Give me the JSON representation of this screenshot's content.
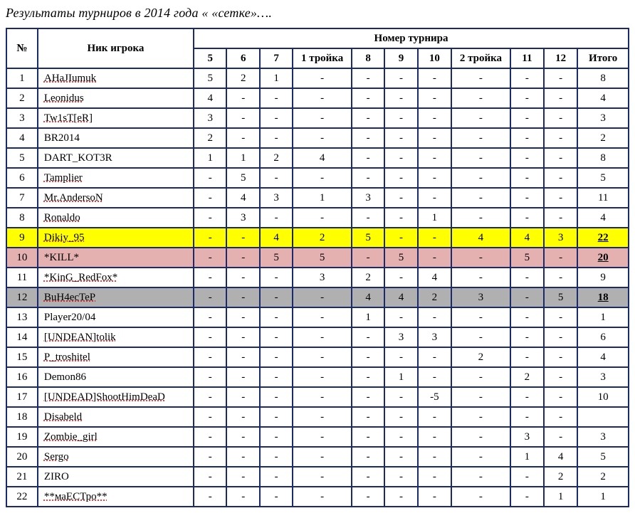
{
  "title": "Результаты турниров  в 2014 года « «сетке»….",
  "headers": {
    "num": "№",
    "nick": "Ник игрока",
    "tourn": "Номер турнира",
    "cols": [
      "5",
      "6",
      "7",
      "1 тройка",
      "8",
      "9",
      "10",
      "2 тройка",
      "11",
      "12",
      "Итого"
    ]
  },
  "rows": [
    {
      "n": "1",
      "name": "AHaJIumuk",
      "c": [
        "5",
        "2",
        "1",
        "-",
        "-",
        "-",
        "-",
        "-",
        "-",
        "-"
      ],
      "total": "8",
      "dotted": true
    },
    {
      "n": "2",
      "name": "Leonidus",
      "c": [
        "4",
        "-",
        "-",
        "-",
        "-",
        "-",
        "-",
        "-",
        "-",
        "-"
      ],
      "total": "4",
      "dotted": true
    },
    {
      "n": "3",
      "name": "Tw1sT[eR]",
      "c": [
        "3",
        "-",
        "-",
        "-",
        "-",
        "-",
        "-",
        "-",
        "-",
        "-"
      ],
      "total": "3",
      "dotted": true
    },
    {
      "n": "4",
      "name": "BR2014",
      "c": [
        "2",
        "-",
        "-",
        "-",
        "-",
        "-",
        "-",
        "-",
        "-",
        "-"
      ],
      "total": "2"
    },
    {
      "n": "5",
      "name": "DART_KOT3R",
      "c": [
        "1",
        "1",
        "2",
        "4",
        "-",
        "-",
        "-",
        "-",
        "-",
        "-"
      ],
      "total": "8"
    },
    {
      "n": "6",
      "name": "Tamplier",
      "c": [
        "-",
        "5",
        "-",
        "-",
        "-",
        "-",
        "-",
        "-",
        "-",
        "-"
      ],
      "total": "5",
      "dotted": true
    },
    {
      "n": "7",
      "name": "Mr.AndersoN",
      "c": [
        "-",
        "4",
        "3",
        "1",
        "3",
        "-",
        "-",
        "-",
        "-",
        "-"
      ],
      "total": "11",
      "dotted": true
    },
    {
      "n": "8",
      "name": "Ronaldo",
      "c": [
        "-",
        "3",
        "-",
        "-",
        "-",
        "-",
        "1",
        "-",
        "-",
        "-"
      ],
      "total": "4",
      "dotted": true
    },
    {
      "n": "9",
      "name": "Dikiy_95",
      "c": [
        "-",
        "-",
        "4",
        "2",
        "5",
        "-",
        "-",
        "4",
        "4",
        "3"
      ],
      "total": "22",
      "hl": "yellow",
      "boldTotal": true,
      "dotted": true
    },
    {
      "n": "10",
      "name": "*KILL*",
      "c": [
        "-",
        "-",
        "5",
        "5",
        "-",
        "5",
        "-",
        "-",
        "5",
        "-"
      ],
      "total": "20",
      "hl": "pink",
      "boldTotal": true
    },
    {
      "n": "11",
      "name": "*KinG_RedFox*",
      "c": [
        "-",
        "-",
        "-",
        "3",
        "2",
        "-",
        "4",
        "-",
        "-",
        "-"
      ],
      "total": "9",
      "dotted": true
    },
    {
      "n": "12",
      "name": "BuH4ecTeP",
      "c": [
        "-",
        "-",
        "-",
        "-",
        "4",
        "4",
        "2",
        "3",
        "-",
        "5"
      ],
      "total": "18",
      "hl": "grey",
      "boldTotal": true,
      "dotted": true
    },
    {
      "n": "13",
      "name": "Player20/04",
      "c": [
        "-",
        "-",
        "-",
        "-",
        "1",
        "-",
        "-",
        "-",
        "-",
        "-"
      ],
      "total": "1"
    },
    {
      "n": "14",
      "name": "[UNDEAN]tolik",
      "c": [
        "-",
        "-",
        "-",
        "-",
        "-",
        "3",
        "3",
        "-",
        "-",
        "-"
      ],
      "total": "6",
      "dotted": true
    },
    {
      "n": "15",
      "name": "P_troshitel",
      "c": [
        "-",
        "-",
        "-",
        "-",
        "-",
        "-",
        "-",
        "2",
        "-",
        "-"
      ],
      "total": "4",
      "dotted": true
    },
    {
      "n": "16",
      "name": "Demon86",
      "c": [
        "-",
        "-",
        "-",
        "-",
        "-",
        "1",
        "-",
        "-",
        "2",
        "-"
      ],
      "total": "3"
    },
    {
      "n": "17",
      "name": "[UNDEAD]ShootHimDeaD",
      "c": [
        "-",
        "-",
        "-",
        "-",
        "-",
        "-",
        "-5",
        "-",
        "-",
        "-"
      ],
      "total": "10",
      "dotted": true
    },
    {
      "n": "18",
      "name": "Disabeld",
      "c": [
        "-",
        "-",
        "-",
        "-",
        "-",
        "-",
        "-",
        "-",
        "-",
        "-"
      ],
      "total": "",
      "dotted": true
    },
    {
      "n": "19",
      "name": "Zombie_girl",
      "c": [
        "-",
        "-",
        "-",
        "-",
        "-",
        "-",
        "-",
        "-",
        "3",
        "-"
      ],
      "total": "3",
      "dotted": true
    },
    {
      "n": "20",
      "name": "Sergo",
      "c": [
        "-",
        "-",
        "-",
        "-",
        "-",
        "-",
        "-",
        "-",
        "1",
        "4"
      ],
      "total": "5",
      "dotted": true
    },
    {
      "n": "21",
      "name": "ZIRO",
      "c": [
        "-",
        "-",
        "-",
        "-",
        "-",
        "-",
        "-",
        "-",
        "-",
        "2"
      ],
      "total": "2"
    },
    {
      "n": "22",
      "name": "**маЕСТро**",
      "c": [
        "-",
        "-",
        "-",
        "-",
        "-",
        "-",
        "-",
        "-",
        "-",
        "1"
      ],
      "total": "1",
      "dotted": true
    }
  ]
}
